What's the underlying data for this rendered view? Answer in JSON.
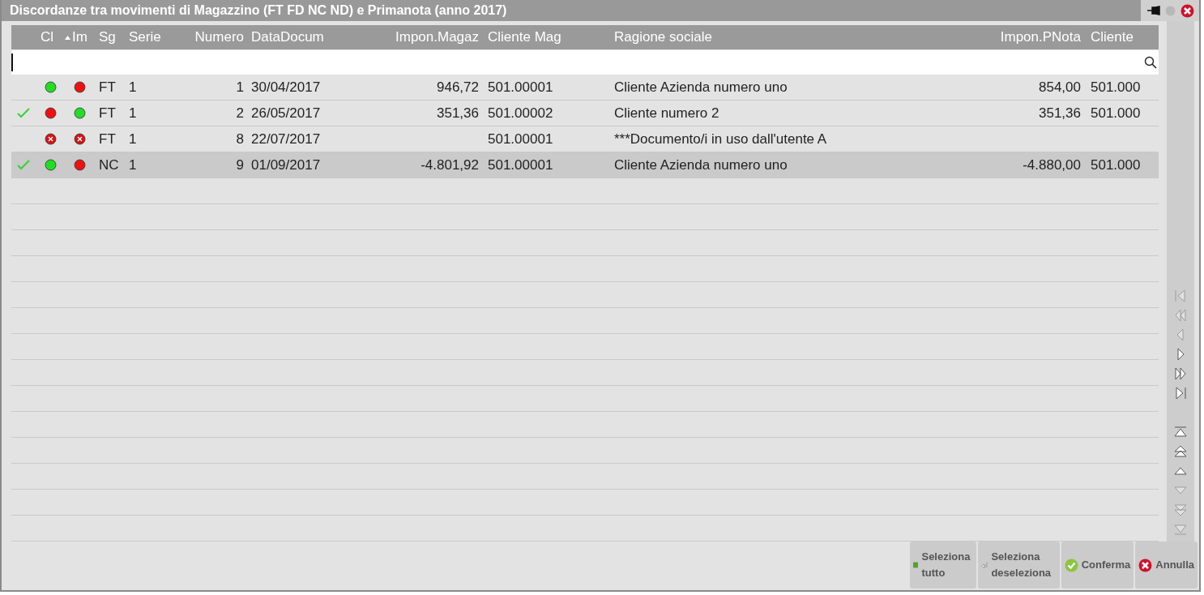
{
  "window": {
    "title": "Discordanze tra movimenti di Magazzino (FT FD NC ND) e Primanota (anno 2017)"
  },
  "table": {
    "columns": [
      {
        "label": "Cl"
      },
      {
        "label": "Im",
        "sorted": true
      },
      {
        "label": "Sg"
      },
      {
        "label": "Serie"
      },
      {
        "label": "Numero"
      },
      {
        "label": "DataDocum"
      },
      {
        "label": "Impon.Magaz"
      },
      {
        "label": "Cliente Mag"
      },
      {
        "label": "Ragione sociale"
      },
      {
        "label": "Impon.PNota"
      },
      {
        "label": "Cliente"
      }
    ],
    "rows": [
      {
        "checked": false,
        "selected": false,
        "cl": {
          "kind": "dot",
          "color": "#22dd22"
        },
        "im": {
          "kind": "dot",
          "color": "#ee1111"
        },
        "sg": "FT",
        "serie": "1",
        "numero": "1",
        "data": "30/04/2017",
        "impon_magaz": "946,72",
        "cliente_mag": "501.00001",
        "ragione_sociale": "Cliente Azienda numero uno",
        "impon_pnota": "854,00",
        "cliente": "501.000"
      },
      {
        "checked": true,
        "selected": false,
        "cl": {
          "kind": "dot",
          "color": "#ee1111"
        },
        "im": {
          "kind": "dot",
          "color": "#22dd22"
        },
        "sg": "FT",
        "serie": "1",
        "numero": "2",
        "data": "26/05/2017",
        "impon_magaz": "351,36",
        "cliente_mag": "501.00002",
        "ragione_sociale": "Cliente numero 2",
        "impon_pnota": "351,36",
        "cliente": "501.000"
      },
      {
        "checked": false,
        "selected": false,
        "cl": {
          "kind": "blocked"
        },
        "im": {
          "kind": "blocked"
        },
        "sg": "FT",
        "serie": "1",
        "numero": "8",
        "data": "22/07/2017",
        "cliente_mag": "501.00001",
        "ragione_sociale": "***Documento/i in uso dall'utente A"
      },
      {
        "checked": true,
        "selected": true,
        "cl": {
          "kind": "dot",
          "color": "#22dd22"
        },
        "im": {
          "kind": "dot",
          "color": "#ee1111"
        },
        "sg": "NC",
        "serie": "1",
        "numero": "9",
        "data": "01/09/2017",
        "impon_magaz": "-4.801,92",
        "cliente_mag": "501.00001",
        "ragione_sociale": "Cliente Azienda numero uno",
        "impon_pnota": "-4.880,00",
        "cliente": "501.000"
      }
    ]
  },
  "buttons": [
    {
      "label": "Seleziona tutto",
      "kind": "select-all"
    },
    {
      "label": "Seleziona deseleziona",
      "kind": "toggle"
    },
    {
      "label": "Conferma",
      "kind": "confirm"
    },
    {
      "label": "Annulla",
      "kind": "cancel"
    }
  ]
}
